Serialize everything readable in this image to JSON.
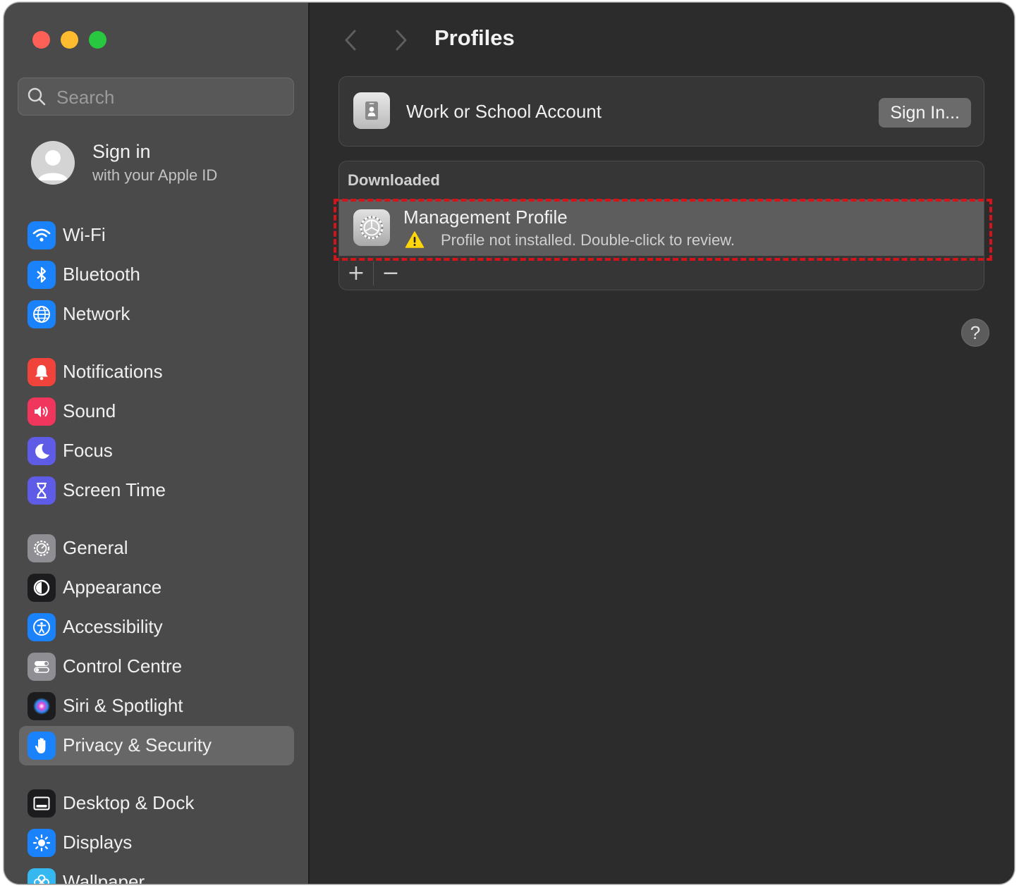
{
  "window": {
    "colors": {
      "close": "#fe5f57",
      "minimize": "#febc2e",
      "maximize": "#28c840"
    }
  },
  "sidebar": {
    "search": {
      "placeholder": "Search",
      "value": ""
    },
    "account": {
      "title": "Sign in",
      "subtitle": "with your Apple ID"
    },
    "items": [
      {
        "label": "Wi-Fi",
        "icon": "wifi-icon",
        "color": "#1a82fb",
        "selected": false
      },
      {
        "label": "Bluetooth",
        "icon": "bluetooth-icon",
        "color": "#1a82fb",
        "selected": false
      },
      {
        "label": "Network",
        "icon": "globe-icon",
        "color": "#1a82fb",
        "selected": false
      },
      {
        "label": "Notifications",
        "icon": "bell-icon",
        "color": "#f0433b",
        "selected": false
      },
      {
        "label": "Sound",
        "icon": "speaker-icon",
        "color": "#f0365c",
        "selected": false
      },
      {
        "label": "Focus",
        "icon": "moon-icon",
        "color": "#5e5ce6",
        "selected": false
      },
      {
        "label": "Screen Time",
        "icon": "hourglass-icon",
        "color": "#5e5ce6",
        "selected": false
      },
      {
        "label": "General",
        "icon": "gear-icon",
        "color": "#8e8e93",
        "selected": false
      },
      {
        "label": "Appearance",
        "icon": "appearance-icon",
        "color": "#1c1c1e",
        "selected": false
      },
      {
        "label": "Accessibility",
        "icon": "accessibility-icon",
        "color": "#1a82fb",
        "selected": false
      },
      {
        "label": "Control Centre",
        "icon": "toggles-icon",
        "color": "#8e8e93",
        "selected": false
      },
      {
        "label": "Siri & Spotlight",
        "icon": "siri-icon",
        "color": "#1c1c1e",
        "selected": false
      },
      {
        "label": "Privacy & Security",
        "icon": "hand-icon",
        "color": "#1a82fb",
        "selected": true
      },
      {
        "label": "Desktop & Dock",
        "icon": "dock-icon",
        "color": "#1c1c1e",
        "selected": false
      },
      {
        "label": "Displays",
        "icon": "sun-icon",
        "color": "#1a82fb",
        "selected": false
      },
      {
        "label": "Wallpaper",
        "icon": "flower-icon",
        "color": "#35b8f0",
        "selected": false
      }
    ]
  },
  "main": {
    "title": "Profiles",
    "account_card": {
      "label": "Work or School Account",
      "button": "Sign In..."
    },
    "downloaded": {
      "section_label": "Downloaded",
      "profile": {
        "name": "Management Profile",
        "status": "Profile not installed. Double-click to review."
      },
      "add_symbol": "+",
      "remove_symbol": "−"
    },
    "help_symbol": "?",
    "highlight_color": "#d3141b"
  }
}
